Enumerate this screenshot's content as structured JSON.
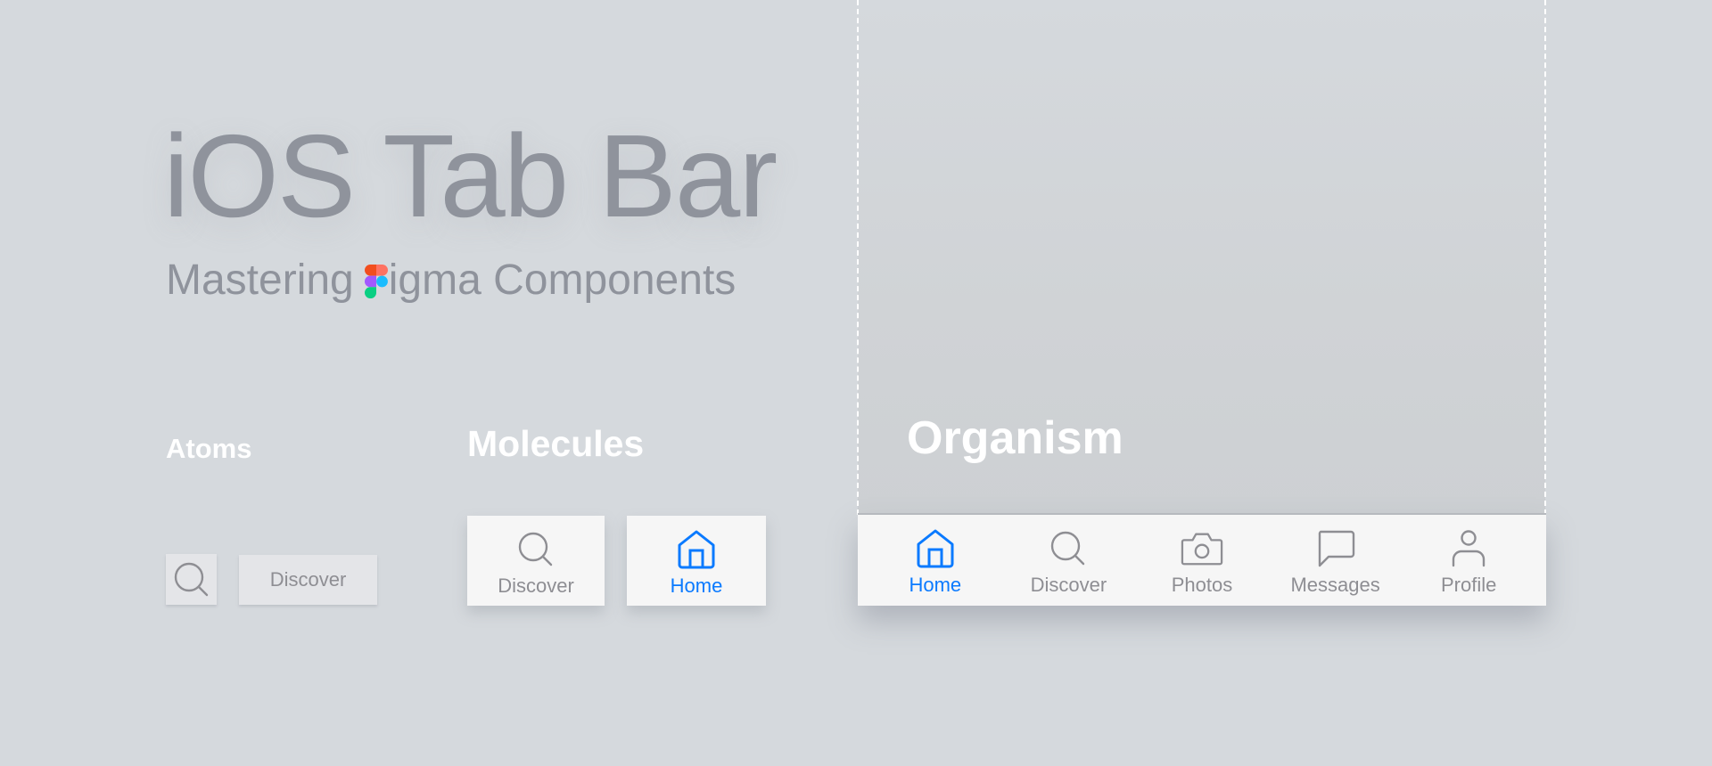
{
  "header": {
    "title": "iOS Tab Bar",
    "subtitle_prefix": "Mastering",
    "subtitle_logo": "figma-logo",
    "subtitle_suffix": "igma Components"
  },
  "sections": {
    "atoms": {
      "heading": "Atoms",
      "items": [
        {
          "type": "icon",
          "icon": "search-icon"
        },
        {
          "type": "label",
          "label": "Discover"
        }
      ]
    },
    "molecules": {
      "heading": "Molecules",
      "items": [
        {
          "label": "Discover",
          "icon": "search-icon",
          "active": false
        },
        {
          "label": "Home",
          "icon": "home-icon",
          "active": true
        }
      ]
    },
    "organism": {
      "heading": "Organism",
      "tabs": [
        {
          "label": "Home",
          "icon": "home-icon",
          "active": true
        },
        {
          "label": "Discover",
          "icon": "search-icon",
          "active": false
        },
        {
          "label": "Photos",
          "icon": "camera-icon",
          "active": false
        },
        {
          "label": "Messages",
          "icon": "message-icon",
          "active": false
        },
        {
          "label": "Profile",
          "icon": "profile-icon",
          "active": false
        }
      ]
    }
  },
  "colors": {
    "background": "#d5d9dd",
    "title_text": "#8f939c",
    "heading_text": "#ffffff",
    "tab_active": "#0a7aff",
    "tab_inactive": "#8e8e93",
    "tab_bar_bg": "#f6f6f6",
    "atom_bg": "#e4e5e8",
    "figma_red": "#f24e1e",
    "figma_orange": "#ff7262",
    "figma_purple": "#a259ff",
    "figma_blue": "#1abcfe",
    "figma_green": "#0acf83"
  }
}
